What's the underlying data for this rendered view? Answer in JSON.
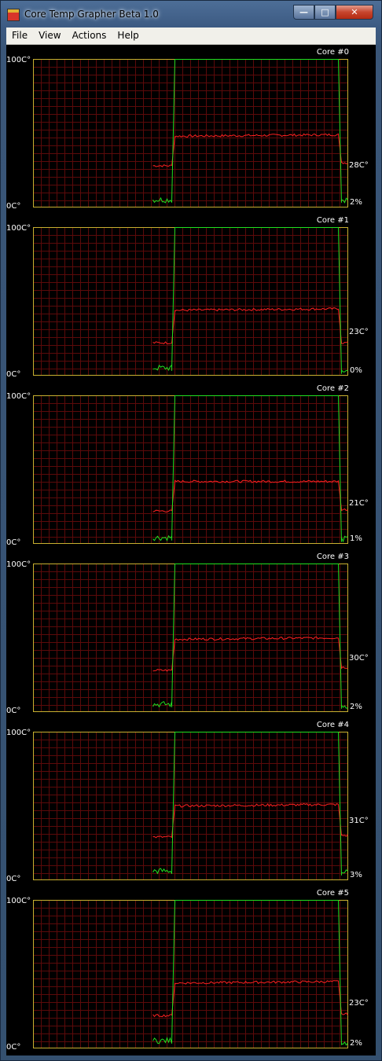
{
  "window": {
    "title": "Core Temp Grapher Beta 1.0",
    "controls": {
      "minimize": "—",
      "maximize": "□",
      "close": "✕"
    }
  },
  "menu": [
    "File",
    "View",
    "Actions",
    "Help"
  ],
  "axis": {
    "max_label": "100C°",
    "min_label": "0C°"
  },
  "colors": {
    "background": "#000000",
    "grid": "#5c0a0a",
    "border": "#c8b030",
    "temperature": "#ff2020",
    "load": "#20e020"
  },
  "chart_data": [
    {
      "type": "line",
      "title": "Core #0",
      "current_temp": "28C°",
      "current_load": "2%",
      "ylim": [
        0,
        100
      ],
      "series": [
        {
          "kind": "temperature",
          "values": [
            [
              0.38,
              28
            ],
            [
              0.44,
              28
            ],
            [
              0.45,
              48
            ],
            [
              0.97,
              49
            ],
            [
              0.98,
              30
            ],
            [
              1.0,
              30
            ]
          ]
        },
        {
          "kind": "load",
          "values": [
            [
              0.38,
              3
            ],
            [
              0.44,
              3
            ],
            [
              0.45,
              100
            ],
            [
              0.97,
              100
            ],
            [
              0.98,
              3
            ],
            [
              1.0,
              3
            ]
          ]
        }
      ]
    },
    {
      "type": "line",
      "title": "Core #1",
      "current_temp": "23C°",
      "current_load": "0%",
      "ylim": [
        0,
        100
      ],
      "series": [
        {
          "kind": "temperature",
          "values": [
            [
              0.38,
              22
            ],
            [
              0.44,
              22
            ],
            [
              0.45,
              44
            ],
            [
              0.97,
              45
            ],
            [
              0.98,
              22
            ],
            [
              1.0,
              22
            ]
          ]
        },
        {
          "kind": "load",
          "values": [
            [
              0.38,
              3
            ],
            [
              0.44,
              3
            ],
            [
              0.45,
              100
            ],
            [
              0.97,
              100
            ],
            [
              0.98,
              1
            ],
            [
              1.0,
              1
            ]
          ]
        }
      ]
    },
    {
      "type": "line",
      "title": "Core #2",
      "current_temp": "21C°",
      "current_load": "1%",
      "ylim": [
        0,
        100
      ],
      "series": [
        {
          "kind": "temperature",
          "values": [
            [
              0.38,
              22
            ],
            [
              0.44,
              22
            ],
            [
              0.45,
              42
            ],
            [
              0.97,
              42
            ],
            [
              0.98,
              23
            ],
            [
              1.0,
              23
            ]
          ]
        },
        {
          "kind": "load",
          "values": [
            [
              0.38,
              2
            ],
            [
              0.44,
              2
            ],
            [
              0.45,
              100
            ],
            [
              0.97,
              100
            ],
            [
              0.98,
              1
            ],
            [
              1.0,
              1
            ]
          ]
        }
      ]
    },
    {
      "type": "line",
      "title": "Core #3",
      "current_temp": "30C°",
      "current_load": "2%",
      "ylim": [
        0,
        100
      ],
      "series": [
        {
          "kind": "temperature",
          "values": [
            [
              0.38,
              28
            ],
            [
              0.44,
              28
            ],
            [
              0.45,
              49
            ],
            [
              0.97,
              50
            ],
            [
              0.98,
              30
            ],
            [
              1.0,
              30
            ]
          ]
        },
        {
          "kind": "load",
          "values": [
            [
              0.38,
              3
            ],
            [
              0.44,
              3
            ],
            [
              0.45,
              100
            ],
            [
              0.97,
              100
            ],
            [
              0.98,
              2
            ],
            [
              1.0,
              2
            ]
          ]
        }
      ]
    },
    {
      "type": "line",
      "title": "Core #4",
      "current_temp": "31C°",
      "current_load": "3%",
      "ylim": [
        0,
        100
      ],
      "series": [
        {
          "kind": "temperature",
          "values": [
            [
              0.38,
              29
            ],
            [
              0.44,
              29
            ],
            [
              0.45,
              50
            ],
            [
              0.97,
              51
            ],
            [
              0.98,
              30
            ],
            [
              1.0,
              30
            ]
          ]
        },
        {
          "kind": "load",
          "values": [
            [
              0.38,
              4
            ],
            [
              0.44,
              4
            ],
            [
              0.45,
              100
            ],
            [
              0.97,
              100
            ],
            [
              0.98,
              3
            ],
            [
              1.0,
              3
            ]
          ]
        }
      ]
    },
    {
      "type": "line",
      "title": "Core #5",
      "current_temp": "23C°",
      "current_load": "2%",
      "ylim": [
        0,
        100
      ],
      "series": [
        {
          "kind": "temperature",
          "values": [
            [
              0.38,
              22
            ],
            [
              0.44,
              22
            ],
            [
              0.45,
              44
            ],
            [
              0.97,
              45
            ],
            [
              0.98,
              23
            ],
            [
              1.0,
              23
            ]
          ]
        },
        {
          "kind": "load",
          "values": [
            [
              0.38,
              3
            ],
            [
              0.44,
              3
            ],
            [
              0.45,
              100
            ],
            [
              0.97,
              100
            ],
            [
              0.98,
              2
            ],
            [
              1.0,
              2
            ]
          ]
        }
      ]
    }
  ]
}
